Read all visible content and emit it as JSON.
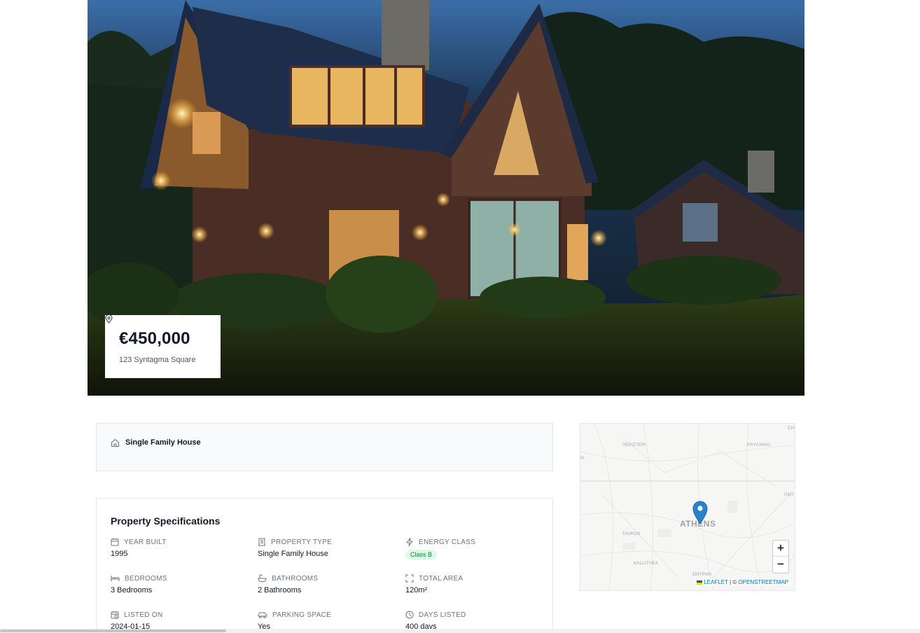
{
  "hero": {
    "image_name": "house-exterior-night",
    "price": "€450,000",
    "address": "123 Syntagma Square"
  },
  "property_type": {
    "label": "Single Family House",
    "icon": "home-icon"
  },
  "specs": {
    "title": "Property Specifications",
    "items": [
      {
        "label": "Year Built",
        "value": "1995",
        "icon": "calendar-icon"
      },
      {
        "label": "Property Type",
        "value": "Single Family House",
        "icon": "building-icon"
      },
      {
        "label": "Energy Class",
        "value": "Class B",
        "icon": "bolt-icon",
        "badge_color": "#dcfce7"
      },
      {
        "label": "Bedrooms",
        "value": "3 Bedrooms",
        "icon": "bed-icon"
      },
      {
        "label": "Bathrooms",
        "value": "2 Bathrooms",
        "icon": "bath-icon"
      },
      {
        "label": "Total Area",
        "value": "120m²",
        "icon": "expand-icon"
      },
      {
        "label": "Listed On",
        "value": "2024-01-15",
        "icon": "calendar-check-icon"
      },
      {
        "label": "Parking Space",
        "value": "Yes",
        "icon": "car-icon"
      },
      {
        "label": "Days Listed",
        "value": "400 days",
        "icon": "clock-icon"
      }
    ]
  },
  "map": {
    "city_label": "ATHENS",
    "district_labels": [
      "ΠΕΡΙΣΤΕΡΙ",
      "PSYCHIKO",
      "TAVROS",
      "KALLITHEA",
      "ΣΜΥΡΝΗ",
      "ΠΑΠ",
      "CH",
      "RI"
    ],
    "zoom_in": "+",
    "zoom_out": "−",
    "attribution_leaflet": "Leaflet",
    "attribution_sep": "| ©",
    "attribution_osm": "OpenStreetMap",
    "marker_color": "#2a81cb"
  },
  "colors": {
    "badge_text": "#15803d",
    "link": "#0078a8"
  }
}
